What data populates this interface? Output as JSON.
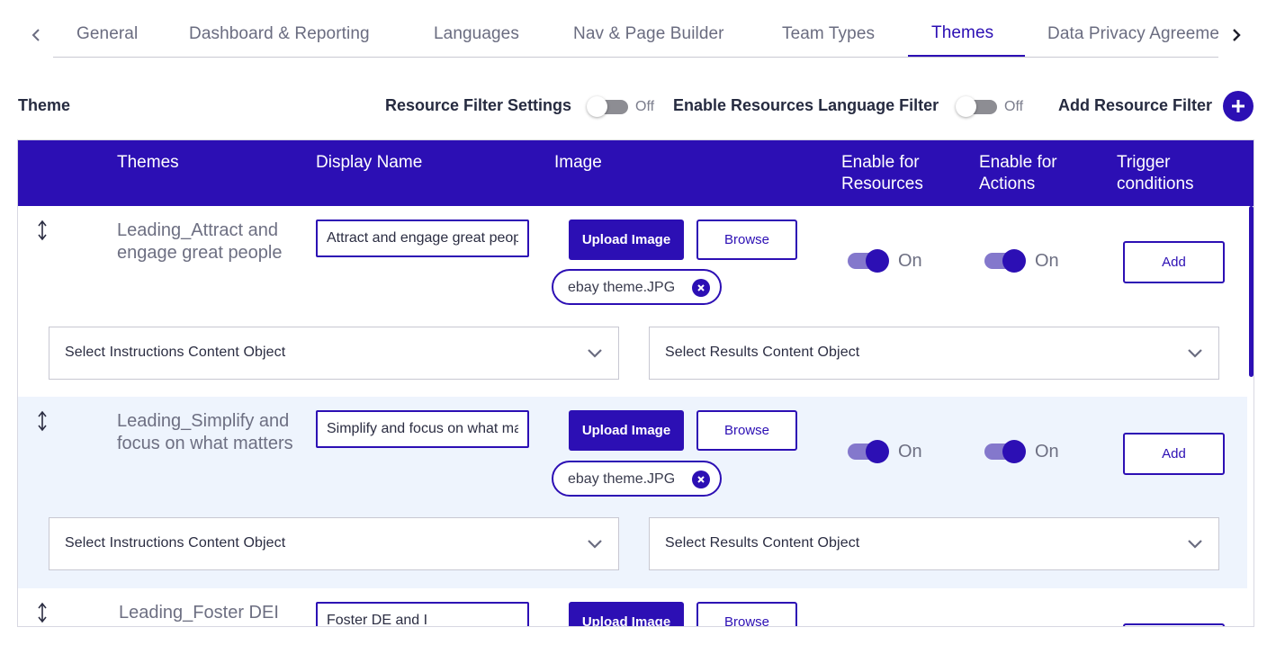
{
  "tabs": {
    "items": [
      {
        "label": "General",
        "active": false
      },
      {
        "label": "Dashboard & Reporting",
        "active": false
      },
      {
        "label": "Languages",
        "active": false
      },
      {
        "label": "Nav & Page Builder",
        "active": false
      },
      {
        "label": "Team Types",
        "active": false
      },
      {
        "label": "Themes",
        "active": true
      },
      {
        "label": "Data Privacy Agreement",
        "active": false
      }
    ]
  },
  "header": {
    "theme_label": "Theme",
    "resource_filter_label": "Resource Filter Settings",
    "resource_filter_state": "Off",
    "language_filter_label": "Enable Resources Language Filter",
    "language_filter_state": "Off",
    "add_filter_label": "Add Resource Filter"
  },
  "table": {
    "columns": {
      "themes": "Themes",
      "display_name": "Display Name",
      "image": "Image",
      "enable_resources_1": "Enable for",
      "enable_resources_2": "Resources",
      "enable_actions_1": "Enable for",
      "enable_actions_2": "Actions",
      "trigger_1": "Trigger",
      "trigger_2": "conditions"
    },
    "rows": [
      {
        "theme": "Leading_Attract and engage great people",
        "display_name": "Attract and engage great people",
        "upload_label": "Upload Image",
        "browse_label": "Browse",
        "file_name": "ebay theme.JPG",
        "resources_state": "On",
        "actions_state": "On",
        "add_label": "Add",
        "instructions_select": "Select Instructions Content Object",
        "results_select": "Select Results Content Object"
      },
      {
        "theme": "Leading_Simplify and focus on what matters",
        "display_name": "Simplify and focus on what matters",
        "upload_label": "Upload Image",
        "browse_label": "Browse",
        "file_name": "ebay theme.JPG",
        "resources_state": "On",
        "actions_state": "On",
        "add_label": "Add",
        "instructions_select": "Select Instructions Content Object",
        "results_select": "Select Results Content Object"
      },
      {
        "theme": "Leading_Foster DEI",
        "display_name": "Foster DE and I",
        "upload_label": "Upload Image",
        "browse_label": "Browse"
      }
    ]
  },
  "colors": {
    "accent": "#2c0fb4",
    "row_alt_bg": "#eef4fd",
    "toggle_on_track": "#8478cc",
    "toggle_off_track": "#8d8d93"
  },
  "icons": [
    "chevron-left-icon",
    "chevron-right-icon",
    "plus-icon",
    "drag-handle-icon",
    "close-circle-icon",
    "chevron-down-icon"
  ]
}
